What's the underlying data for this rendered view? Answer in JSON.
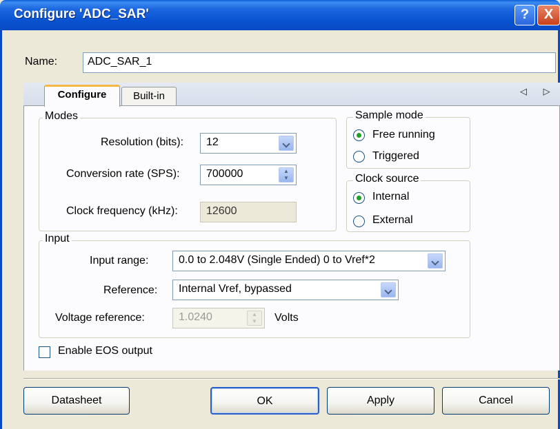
{
  "window": {
    "title": "Configure 'ADC_SAR'",
    "help_glyph": "?",
    "close_glyph": "X"
  },
  "name_field": {
    "label": "Name:",
    "value": "ADC_SAR_1"
  },
  "tabs": [
    {
      "label": "Configure",
      "selected": true
    },
    {
      "label": "Built-in",
      "selected": false
    }
  ],
  "tab_scroll_arrows": "◁ ▷",
  "modes": {
    "title": "Modes",
    "resolution_label": "Resolution (bits):",
    "resolution_value": "12",
    "conversion_rate_label": "Conversion rate (SPS):",
    "conversion_rate_value": "700000",
    "clock_frequency_label": "Clock frequency (kHz):",
    "clock_frequency_value": "12600"
  },
  "sample_mode": {
    "title": "Sample mode",
    "options": [
      {
        "label": "Free running",
        "selected": true
      },
      {
        "label": "Triggered",
        "selected": false
      }
    ]
  },
  "clock_source": {
    "title": "Clock source",
    "options": [
      {
        "label": "Internal",
        "selected": true
      },
      {
        "label": "External",
        "selected": false
      }
    ]
  },
  "input": {
    "title": "Input",
    "input_range_label": "Input range:",
    "input_range_value": "0.0 to 2.048V (Single Ended) 0 to Vref*2",
    "reference_label": "Reference:",
    "reference_value": "Internal Vref, bypassed",
    "voltage_reference_label": "Voltage reference:",
    "voltage_reference_value": "1.0240",
    "voltage_unit": "Volts"
  },
  "eos": {
    "label": "Enable EOS output",
    "checked": false
  },
  "buttons": {
    "datasheet": "Datasheet",
    "ok": "OK",
    "apply": "Apply",
    "cancel": "Cancel"
  }
}
